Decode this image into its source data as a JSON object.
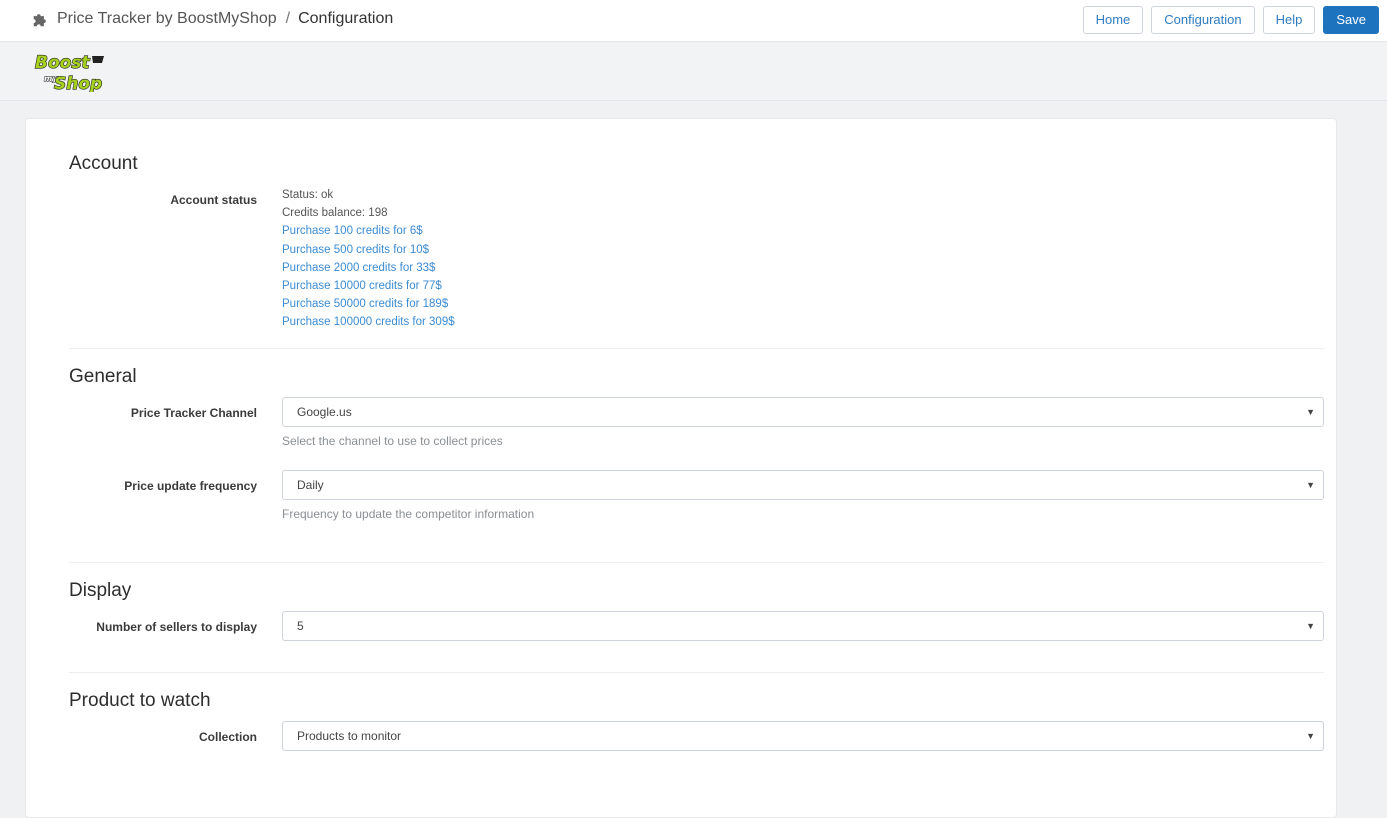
{
  "header": {
    "app_name": "Price Tracker by BoostMyShop",
    "separator": "/",
    "page_name": "Configuration",
    "buttons": {
      "home": "Home",
      "configuration": "Configuration",
      "help": "Help",
      "save": "Save"
    }
  },
  "logo": {
    "line1": "Boost",
    "small": "my",
    "line2": "Shop"
  },
  "icons": {
    "app": "puzzle-piece-icon",
    "select": "caret-down-icon"
  },
  "colors": {
    "primary": "#1e73be",
    "link": "#3b8bd3",
    "logo_green": "#a6d11e"
  },
  "sections": {
    "account": {
      "title": "Account",
      "status_label": "Account status",
      "status_text": "Status: ok",
      "credits_text": "Credits balance: 198",
      "purchase_links": [
        "Purchase 100 credits for 6$",
        "Purchase 500 credits for 10$",
        "Purchase 2000 credits for 33$",
        "Purchase 10000 credits for 77$",
        "Purchase 50000 credits for 189$",
        "Purchase 100000 credits for 309$"
      ]
    },
    "general": {
      "title": "General",
      "channel_label": "Price Tracker Channel",
      "channel_value": "Google.us",
      "channel_help": "Select the channel to use to collect prices",
      "frequency_label": "Price update frequency",
      "frequency_value": "Daily",
      "frequency_help": "Frequency to update the competitor information"
    },
    "display": {
      "title": "Display",
      "sellers_label": "Number of sellers to display",
      "sellers_value": "5"
    },
    "product": {
      "title": "Product to watch",
      "collection_label": "Collection",
      "collection_value": "Products to monitor"
    }
  }
}
